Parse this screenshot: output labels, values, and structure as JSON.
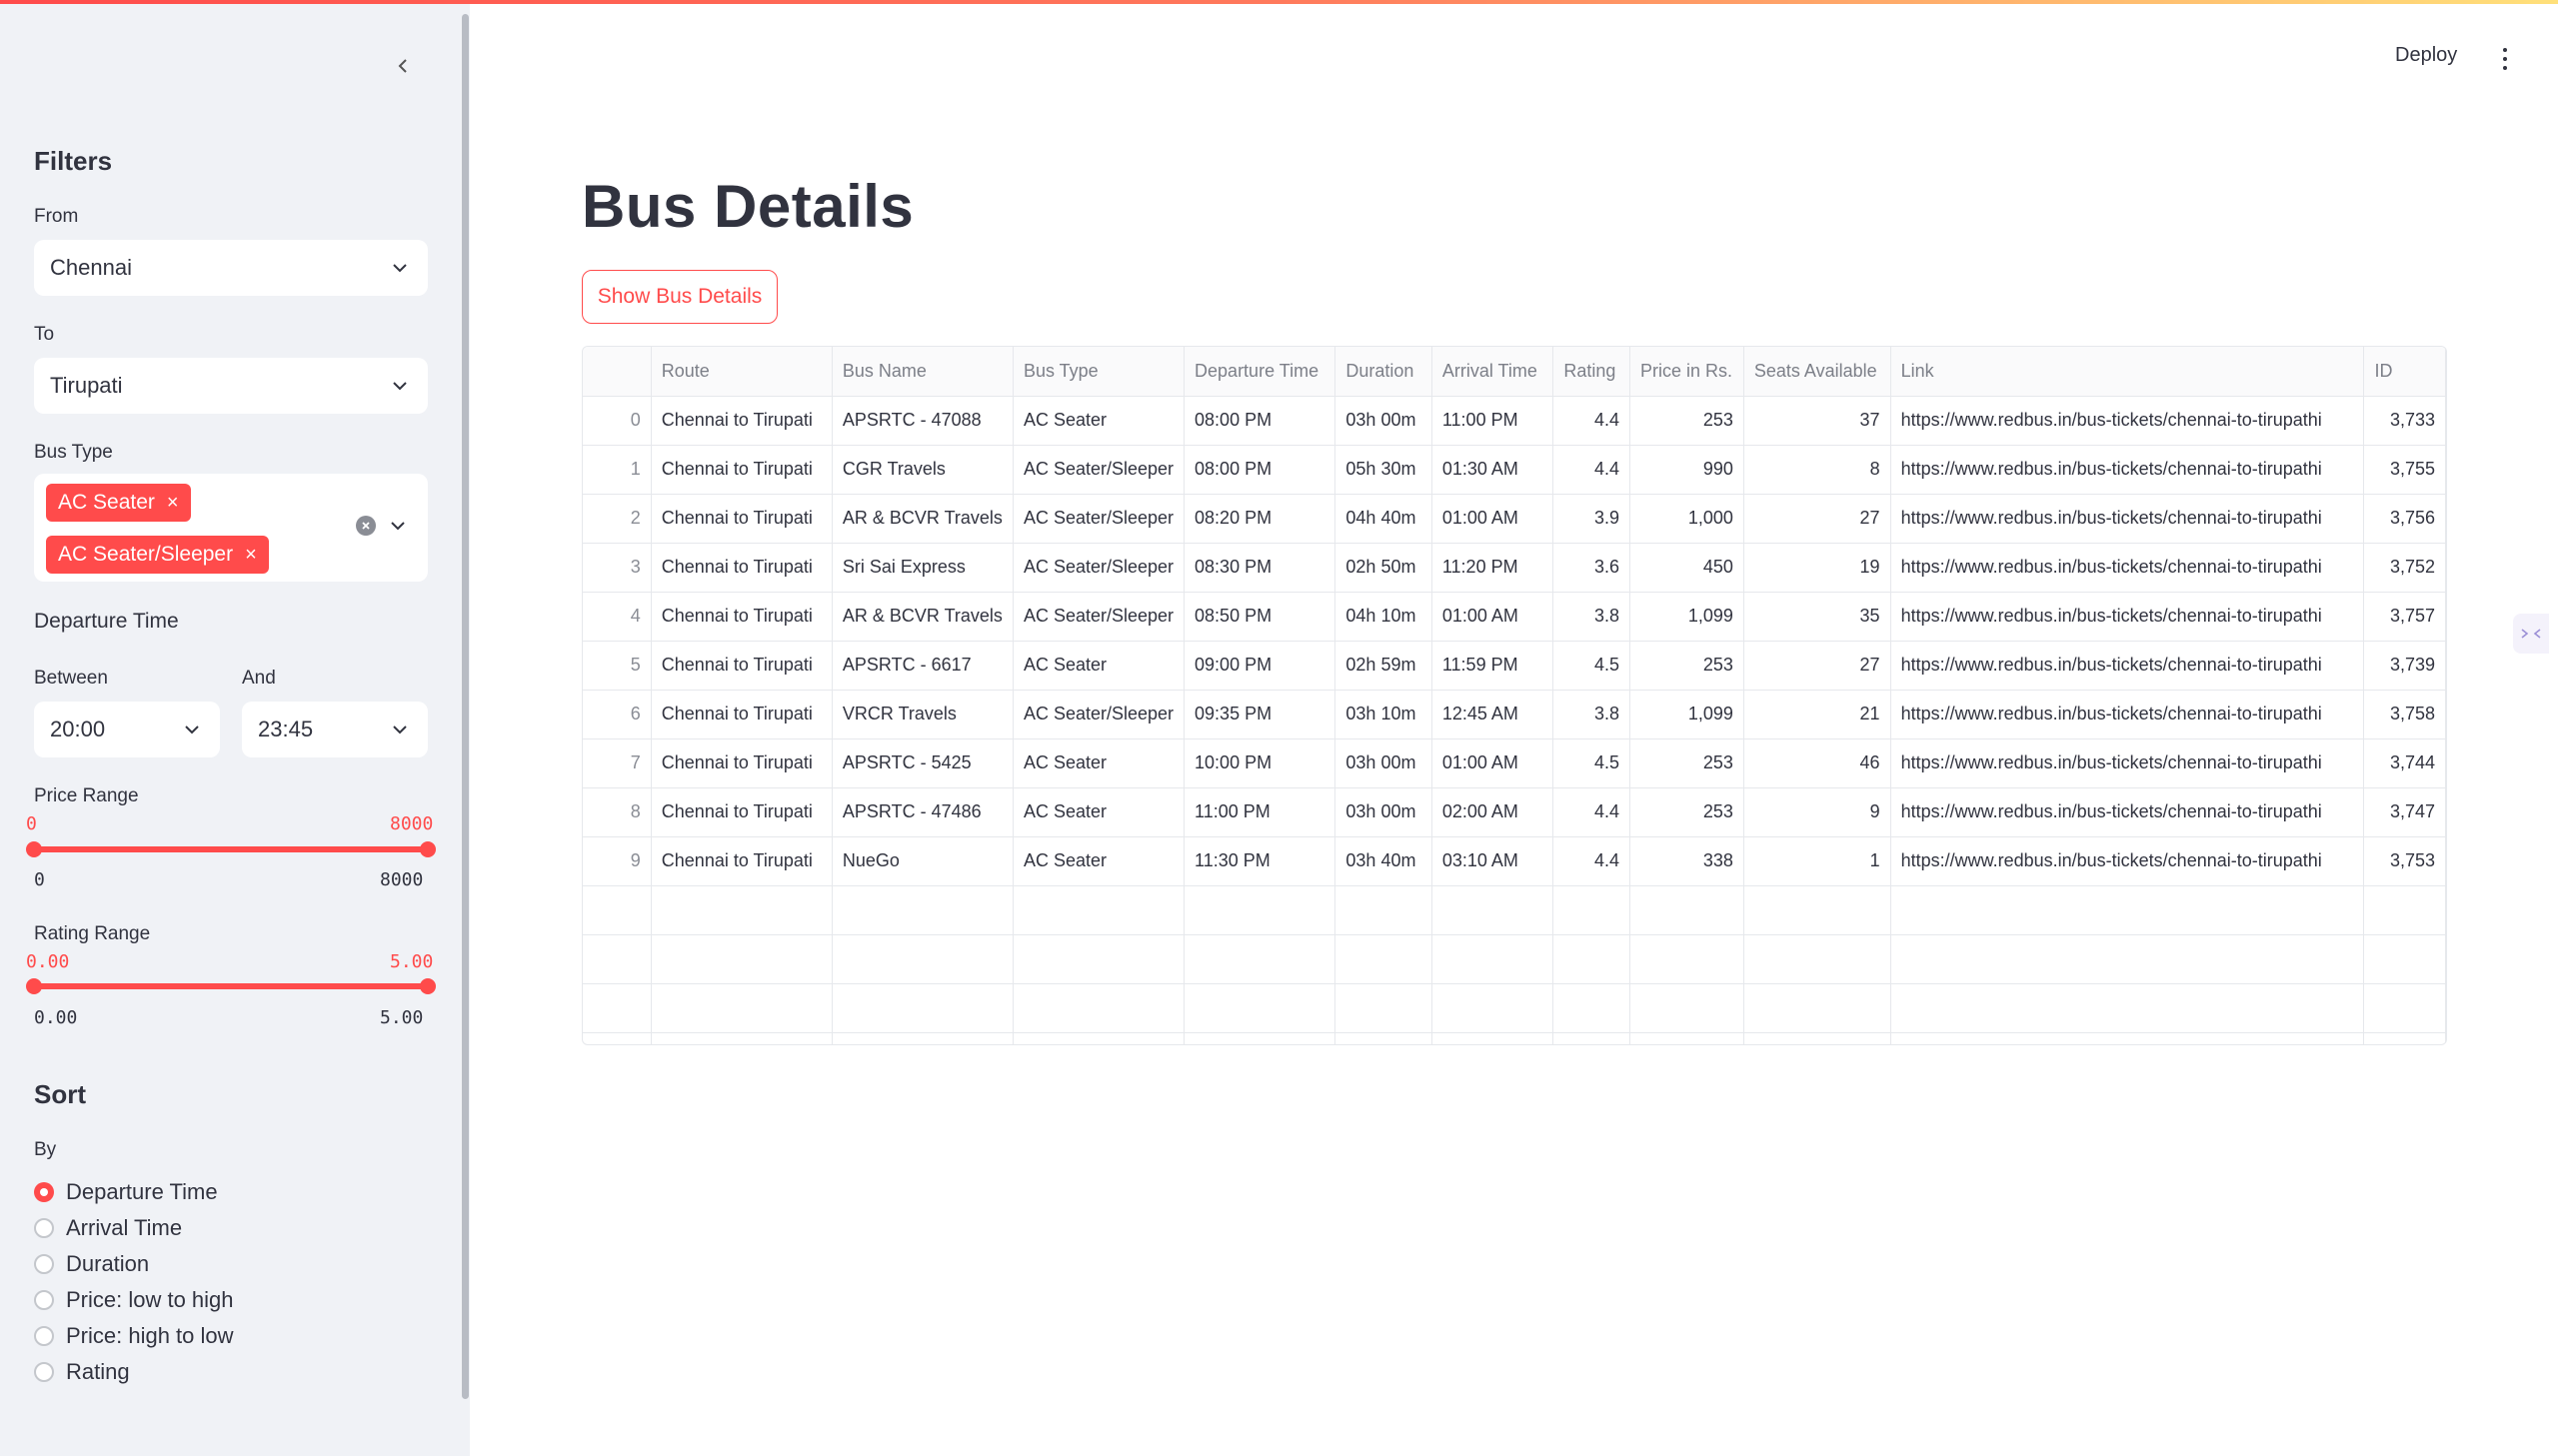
{
  "app": {
    "deploy_label": "Deploy"
  },
  "sidebar": {
    "filters_heading": "Filters",
    "from": {
      "label": "From",
      "value": "Chennai"
    },
    "to": {
      "label": "To",
      "value": "Tirupati"
    },
    "bus_type": {
      "label": "Bus Type",
      "selected": [
        "AC Seater",
        "AC Seater/Sleeper"
      ]
    },
    "departure": {
      "heading": "Departure Time",
      "between_label": "Between",
      "between_value": "20:00",
      "and_label": "And",
      "and_value": "23:45"
    },
    "price_range": {
      "label": "Price Range",
      "min_value": "0",
      "max_value": "8000",
      "min_bound": "0",
      "max_bound": "8000",
      "selected_fraction": [
        0,
        1
      ]
    },
    "rating_range": {
      "label": "Rating Range",
      "min_value": "0.00",
      "max_value": "5.00",
      "min_bound": "0.00",
      "max_bound": "5.00",
      "selected_fraction": [
        0,
        1
      ]
    },
    "sort": {
      "heading": "Sort",
      "by_label": "By",
      "options": [
        "Departure Time",
        "Arrival Time",
        "Duration",
        "Price: low to high",
        "Price: high to low",
        "Rating"
      ],
      "selected": "Departure Time"
    }
  },
  "main": {
    "title": "Bus Details",
    "show_button": "Show Bus Details",
    "table": {
      "columns": [
        "",
        "Route",
        "Bus Name",
        "Bus Type",
        "Departure Time",
        "Duration",
        "Arrival Time",
        "Rating",
        "Price in Rs.",
        "Seats Available",
        "Link",
        "ID"
      ],
      "rows": [
        [
          "0",
          "Chennai to Tirupati",
          "APSRTC - 47088",
          "AC Seater",
          "08:00 PM",
          "03h 00m",
          "11:00 PM",
          "4.4",
          "253",
          "37",
          "https://www.redbus.in/bus-tickets/chennai-to-tirupathi",
          "3,733"
        ],
        [
          "1",
          "Chennai to Tirupati",
          "CGR Travels",
          "AC Seater/Sleeper",
          "08:00 PM",
          "05h 30m",
          "01:30 AM",
          "4.4",
          "990",
          "8",
          "https://www.redbus.in/bus-tickets/chennai-to-tirupathi",
          "3,755"
        ],
        [
          "2",
          "Chennai to Tirupati",
          "AR & BCVR Travels",
          "AC Seater/Sleeper",
          "08:20 PM",
          "04h 40m",
          "01:00 AM",
          "3.9",
          "1,000",
          "27",
          "https://www.redbus.in/bus-tickets/chennai-to-tirupathi",
          "3,756"
        ],
        [
          "3",
          "Chennai to Tirupati",
          "Sri Sai Express",
          "AC Seater/Sleeper",
          "08:30 PM",
          "02h 50m",
          "11:20 PM",
          "3.6",
          "450",
          "19",
          "https://www.redbus.in/bus-tickets/chennai-to-tirupathi",
          "3,752"
        ],
        [
          "4",
          "Chennai to Tirupati",
          "AR & BCVR Travels",
          "AC Seater/Sleeper",
          "08:50 PM",
          "04h 10m",
          "01:00 AM",
          "3.8",
          "1,099",
          "35",
          "https://www.redbus.in/bus-tickets/chennai-to-tirupathi",
          "3,757"
        ],
        [
          "5",
          "Chennai to Tirupati",
          "APSRTC - 6617",
          "AC Seater",
          "09:00 PM",
          "02h 59m",
          "11:59 PM",
          "4.5",
          "253",
          "27",
          "https://www.redbus.in/bus-tickets/chennai-to-tirupathi",
          "3,739"
        ],
        [
          "6",
          "Chennai to Tirupati",
          "VRCR Travels",
          "AC Seater/Sleeper",
          "09:35 PM",
          "03h 10m",
          "12:45 AM",
          "3.8",
          "1,099",
          "21",
          "https://www.redbus.in/bus-tickets/chennai-to-tirupathi",
          "3,758"
        ],
        [
          "7",
          "Chennai to Tirupati",
          "APSRTC - 5425",
          "AC Seater",
          "10:00 PM",
          "03h 00m",
          "01:00 AM",
          "4.5",
          "253",
          "46",
          "https://www.redbus.in/bus-tickets/chennai-to-tirupathi",
          "3,744"
        ],
        [
          "8",
          "Chennai to Tirupati",
          "APSRTC - 47486",
          "AC Seater",
          "11:00 PM",
          "03h 00m",
          "02:00 AM",
          "4.4",
          "253",
          "9",
          "https://www.redbus.in/bus-tickets/chennai-to-tirupathi",
          "3,747"
        ],
        [
          "9",
          "Chennai to Tirupati",
          "NueGo",
          "AC Seater",
          "11:30 PM",
          "03h 40m",
          "03:10 AM",
          "4.4",
          "338",
          "1",
          "https://www.redbus.in/bus-tickets/chennai-to-tirupathi",
          "3,753"
        ]
      ]
    }
  },
  "colors": {
    "accent": "#ff4b4b",
    "sidebar_bg": "#f0f2f6",
    "text": "#31333f"
  },
  "icons": [
    "chevron-left-icon",
    "chevron-down-icon",
    "clear-circle-icon",
    "kebab-menu-icon",
    "side-panel-icon"
  ]
}
